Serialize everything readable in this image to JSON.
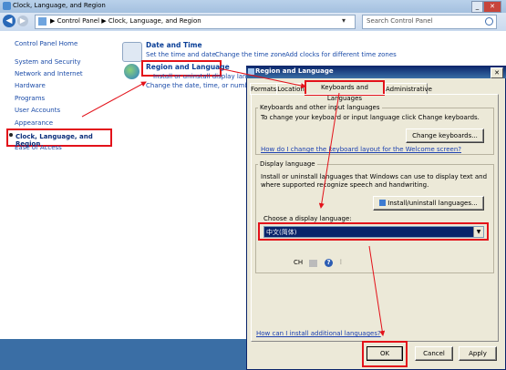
{
  "control_panel": {
    "title": "Clock, Language, and Region",
    "breadcrumb": "▶ Control Panel ▶ Clock, Language, and Region",
    "search_placeholder": "Search Control Panel",
    "nav": {
      "home": "Control Panel Home",
      "items": [
        "System and Security",
        "Network and Internet",
        "Hardware",
        "Programs",
        "User Accounts",
        "Appearance",
        "Clock, Language, and Region",
        "Ease of Access"
      ]
    },
    "date_time": {
      "heading": "Date and Time",
      "links": [
        "Set the time and date",
        "Change the time zone",
        "Add clocks for different time zones"
      ]
    },
    "region_language": {
      "heading": "Region and Language",
      "links": [
        "Install or uninstall display langua",
        "Change the date, time, or number f"
      ]
    }
  },
  "dialog": {
    "title": "Region and Language",
    "tabs": [
      "Formats",
      "Location",
      "Keyboards and Languages",
      "Administrative"
    ],
    "active_tab": "Keyboards and Languages",
    "keyboards": {
      "group_title": "Keyboards and other input languages",
      "description": "To change your keyboard or input language click Change keyboards.",
      "button": "Change keyboards...",
      "link": "How do I change the keyboard layout for the Welcome screen?"
    },
    "display_language": {
      "group_title": "Display language",
      "description_line1": "Install or uninstall languages that Windows can use to display text and",
      "description_line2": "where supported recognize speech and handwriting.",
      "button": "Install/uninstall languages...",
      "choose_label": "Choose a display language:",
      "selected": "中文(简体)"
    },
    "language_bar": {
      "code": "CH"
    },
    "bottom_link": "How can I install additional languages?",
    "buttons": {
      "ok": "OK",
      "cancel": "Cancel",
      "apply": "Apply"
    }
  },
  "colors": {
    "highlight_red": "#e3121a",
    "title_blue": "#0a246a"
  }
}
